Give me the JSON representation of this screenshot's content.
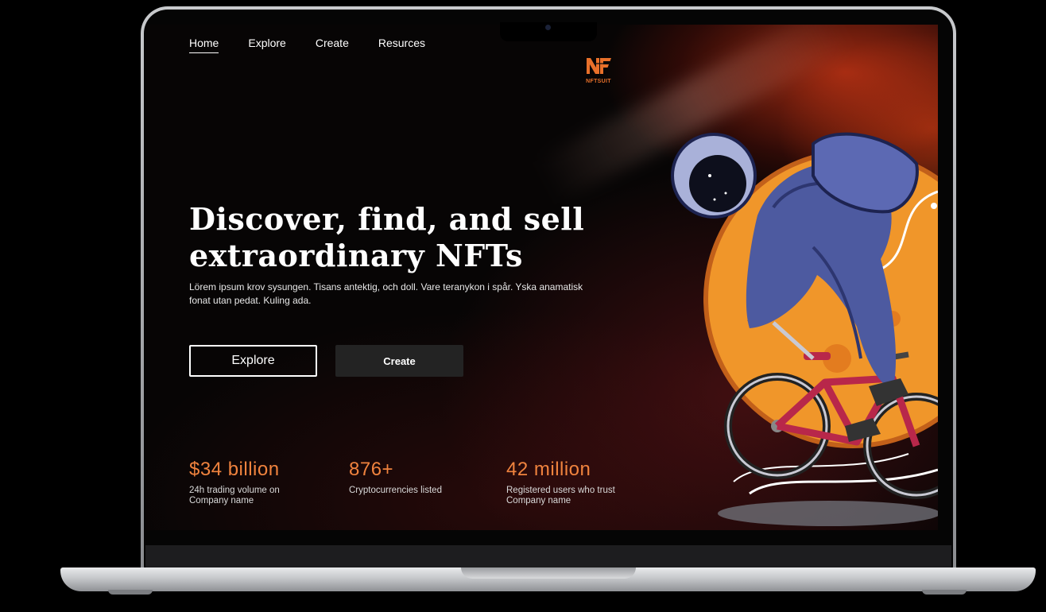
{
  "nav": {
    "items": [
      {
        "label": "Home",
        "active": true
      },
      {
        "label": "Explore",
        "active": false
      },
      {
        "label": "Create",
        "active": false
      },
      {
        "label": "Resurces",
        "active": false
      }
    ]
  },
  "brand": {
    "logo_text": "NFTSUIT",
    "accent": "#e8702a"
  },
  "hero": {
    "title": "Discover, find, and  sell extraordinary NFTs",
    "description": "Lörem ipsum krov sysungen. Tisans antektig, och doll. Vare teranykon i spår. Yska anamatisk fonat utan pedat. Kuling ada.",
    "primary_button": "Explore",
    "secondary_button": "Create"
  },
  "stats": [
    {
      "value": "$34 billion",
      "label": "24h trading volume on Company name"
    },
    {
      "value": "876+",
      "label": "Cryptocurrencies listed"
    },
    {
      "value": "42 million",
      "label": "Registered users who trust Company name"
    }
  ],
  "colors": {
    "stat_value": "#f0833e",
    "background": "#070505",
    "planet": "#f0962a"
  },
  "icons": [
    "nftsuit-logo-icon",
    "astronaut-bike-illustration"
  ]
}
